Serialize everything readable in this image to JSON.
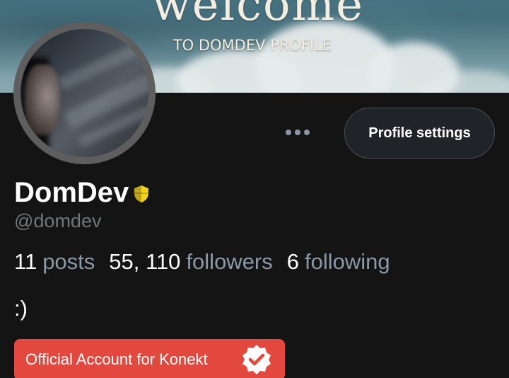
{
  "banner": {
    "title": "welcome",
    "subtitle": "TO DOMDEV PROFILE"
  },
  "profile": {
    "display_name": "DomDev",
    "handle": "@domdev",
    "bio": ":)",
    "official_badge_label": "Official Account for Konekt"
  },
  "actions": {
    "settings_label": "Profile settings",
    "more_icon": "more-horizontal-icon"
  },
  "stats": [
    {
      "value": "11",
      "label": "posts"
    },
    {
      "value": "55, 110",
      "label": "followers"
    },
    {
      "value": "6",
      "label": "following"
    }
  ],
  "colors": {
    "background": "#141414",
    "badge": "#e2483d",
    "shield": "#f2d21b",
    "muted_text": "#8b98a5"
  }
}
